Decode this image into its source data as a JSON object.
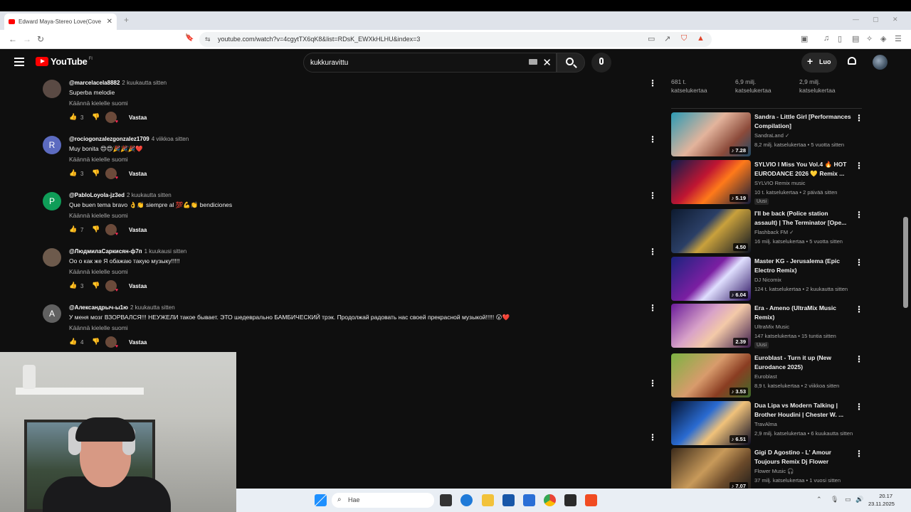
{
  "browser": {
    "tab_title": "Edward Maya-Stereo Love(Cove",
    "tab_close": "✕",
    "new_tab": "+",
    "url": "youtube.com/watch?v=4cgytTX6qK8&list=RDsK_EWXkHLHU&index=3",
    "back": "←",
    "forward": "→",
    "reload": "↻",
    "bookmark": "🔖",
    "site_info": "⇆",
    "win_min": "—",
    "win_max": "▢",
    "win_close": "✕"
  },
  "youtube": {
    "logo_text": "YouTube",
    "country_code": "FI",
    "search_value": "kukkuravittu",
    "search_clear": "✕",
    "create_plus": "+",
    "create_label": "Luo"
  },
  "comments": [
    {
      "user": "@marcelacela8882",
      "time": "2 kuukautta sitten",
      "text": "Superba melodie",
      "translate": "Käännä kielelle suomi",
      "likes": "3",
      "reply": "Vastaa",
      "avatar_letter": "",
      "avatar_color": "#5a4a44"
    },
    {
      "user": "@rociogonzalezgonzalez1709",
      "time": "4 viikkoa sitten",
      "text": "Muy bonita 😍😍🎉🎉🎉❤️",
      "translate": "Käännä kielelle suomi",
      "likes": "3",
      "reply": "Vastaa",
      "avatar_letter": "R",
      "avatar_color": "#5c6bc0"
    },
    {
      "user": "@PabloLoyola-jz3ed",
      "time": "2 kuukautta sitten",
      "text": "Que buen tema bravo 👌👏 siempre al 💯💪👏 bendiciones",
      "translate": "Käännä kielelle suomi",
      "likes": "7",
      "reply": "Vastaa",
      "avatar_letter": "P",
      "avatar_color": "#0f9d58"
    },
    {
      "user": "@ЛюдмилаСаркисян-ф7п",
      "time": "1 kuukausi sitten",
      "text": "Оо о как же Я обажаю такую музыку!!!!!",
      "translate": "Käännä kielelle suomi",
      "likes": "3",
      "reply": "Vastaa",
      "avatar_letter": "",
      "avatar_color": "#6d5a4c"
    },
    {
      "user": "@Александрыч-ы1ю",
      "time": "2 kuukautta sitten",
      "text": "У меня мозг ВЗОРВАЛСЯ!!! НЕУЖЕЛИ такое бывает. ЭТО шедеврально БАМБИЧЕСКИЙ трэк. Продолжай радовать нас своей прекрасной музыкой!!!!! 😮❤️",
      "translate": "Käännä kielelle suomi",
      "likes": "4",
      "reply": "Vastaa",
      "avatar_letter": "A",
      "avatar_color": "#616161"
    }
  ],
  "top_stats": [
    {
      "line1": "681 t.",
      "line2": "katselukertaa"
    },
    {
      "line1": "6,9 milj.",
      "line2": "katselukertaa"
    },
    {
      "line1": "2,9 milj.",
      "line2": "katselukertaa"
    }
  ],
  "recommendations": [
    {
      "title": "Sandra - Little Girl [Performances Compilation]",
      "channel": "SandraLand ✓",
      "meta": "8,2 milj. katselukertaa • 5 vuotta sitten",
      "duration": "♪ 7.28",
      "badge": "",
      "thumb": "linear-gradient(135deg,#2b9ab4 0%,#e3b49c 45%,#8b4a3a 75%,#1f4a66 100%)"
    },
    {
      "title": "SYLVIO I Miss You Vol.4 🔥 HOT EURODANCE 2026 💛 Remix ...",
      "channel": "SYLVIO Remix music",
      "meta": "10 t. katselukertaa • 2 päivää sitten",
      "duration": "♪ 5.19",
      "badge": "Uusi",
      "thumb": "linear-gradient(135deg,#0b1c4d 0%,#c01632 40%,#ff7a1a 60%,#101a3a 100%)"
    },
    {
      "title": "I'll be back (Police station assault) | The Terminator [Ope...",
      "channel": "Flashback FM ✓",
      "meta": "16 milj. katselukertaa • 5 vuotta sitten",
      "duration": "4.50",
      "badge": "",
      "thumb": "linear-gradient(135deg,#0d1a2f 0%,#2b3f66 40%,#c9a13c 55%,#0b1221 100%)"
    },
    {
      "title": "Master KG - Jerusalema (Epic Electro Remix)",
      "channel": "DJ Nicomix",
      "meta": "124 t. katselukertaa • 2 kuukautta sitten",
      "duration": "♪ 6.04",
      "badge": "",
      "thumb": "linear-gradient(135deg,#1a237e 0%,#7b1fa2 45%,#e0e0ff 60%,#2a1060 100%)"
    },
    {
      "title": "Era - Ameno (UltraMix Music Remix)",
      "channel": "UltraMix Music",
      "meta": "147 katselukertaa • 15 tuntia sitten",
      "duration": "2.39",
      "badge": "Uusi",
      "thumb": "linear-gradient(135deg,#6a1b9a 0%,#d8a2c8 40%,#f3c9a8 60%,#3a1a4a 100%)"
    },
    {
      "title": "Euroblast - Turn it up (New Eurodance 2025)",
      "channel": "Euroblast",
      "meta": "8,9 t. katselukertaa • 2 viikkoa sitten",
      "duration": "♪ 3.53",
      "badge": "",
      "thumb": "linear-gradient(135deg,#7cb342 0%,#d89b6c 45%,#8a3d22 70%,#3d6b2a 100%)"
    },
    {
      "title": "Dua Lipa vs Modern Talking | Brother Houdini | Chester W. ...",
      "channel": "TravAlma",
      "meta": "2,9 milj. katselukertaa • 6 kuukautta sitten",
      "duration": "♪ 6.51",
      "badge": "",
      "thumb": "linear-gradient(135deg,#04122e 0%,#2a6bd1 40%,#f0c27a 60%,#0a0a22 100%)"
    },
    {
      "title": "Gigi D Agostino - L' Amour Toujours Remix Dj Flower",
      "channel": "Flower Music 🎧",
      "meta": "37 milj. katselukertaa • 1 vuosi sitten",
      "duration": "♪ 7.07",
      "badge": "",
      "thumb": "linear-gradient(135deg,#3b2a1a 0%,#c89a5a 45%,#6b4a2a 70%,#1a1a1a 100%)"
    }
  ],
  "taskbar": {
    "search_placeholder": "Hae",
    "time": "20.17",
    "date": "23.11.2025"
  }
}
